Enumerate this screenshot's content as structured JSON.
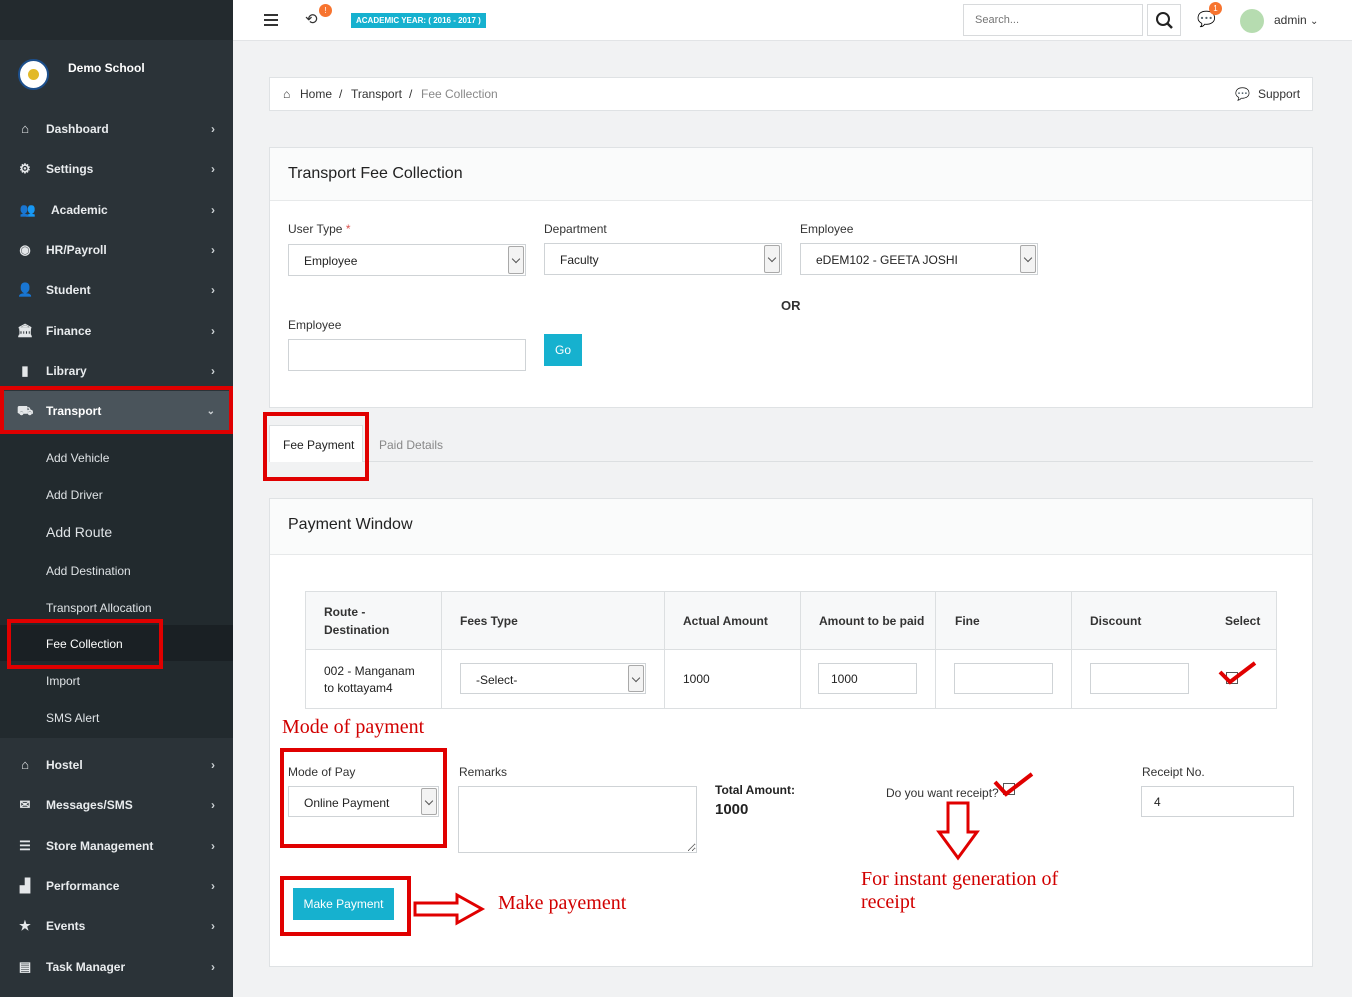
{
  "app": {
    "school_name": "Demo School",
    "academic_year": "ACADEMIC YEAR: ( 2016 - 2017 )",
    "sync_badge": "!",
    "chat_badge": "1",
    "search_placeholder": "Search...",
    "user": "admin"
  },
  "sidebar": {
    "items": [
      {
        "label": "Dashboard",
        "icon": "dashboard-icon"
      },
      {
        "label": "Settings",
        "icon": "gear-icon"
      },
      {
        "label": "Academic",
        "icon": "users-icon"
      },
      {
        "label": "HR/Payroll",
        "icon": "eye-icon"
      },
      {
        "label": "Student",
        "icon": "user-icon"
      },
      {
        "label": "Finance",
        "icon": "bank-icon"
      },
      {
        "label": "Library",
        "icon": "book-icon"
      },
      {
        "label": "Transport",
        "icon": "truck-icon"
      },
      {
        "label": "Hostel",
        "icon": "home-icon"
      },
      {
        "label": "Messages/SMS",
        "icon": "envelope-icon"
      },
      {
        "label": "Store Management",
        "icon": "list-icon"
      },
      {
        "label": "Performance",
        "icon": "chart-icon"
      },
      {
        "label": "Events",
        "icon": "star-icon"
      },
      {
        "label": "Task Manager",
        "icon": "tasks-icon"
      }
    ],
    "transport_sub": [
      "Add Vehicle",
      "Add Driver",
      "Add Route",
      "Add Destination",
      "Transport Allocation",
      "Fee Collection",
      "Import",
      "SMS Alert"
    ]
  },
  "breadcrumb": {
    "home": "Home",
    "transport": "Transport",
    "current": "Fee Collection",
    "support": "Support"
  },
  "form": {
    "title": "Transport Fee Collection",
    "user_type_label": "User Type",
    "required_mark": "*",
    "user_type_value": "Employee",
    "department_label": "Department",
    "department_value": "Faculty",
    "employee_label": "Employee",
    "employee_value": "eDEM102 - GEETA JOSHI",
    "or_text": "OR",
    "employee2_label": "Employee",
    "go_label": "Go"
  },
  "tabs": {
    "fee_payment": "Fee Payment",
    "paid_details": "Paid Details"
  },
  "payment": {
    "title": "Payment Window",
    "columns": {
      "route": "Route -",
      "route2": "Destination",
      "fees_type": "Fees Type",
      "actual": "Actual Amount",
      "to_pay": "Amount to be paid",
      "fine": "Fine",
      "discount": "Discount",
      "select": "Select"
    },
    "row": {
      "route_line1": "002 - Manganam",
      "route_line2": "to kottayam4",
      "fees_type": "-Select-",
      "actual": "1000",
      "to_pay": "1000"
    },
    "mode_label": "Mode of Pay",
    "mode_value": "Online Payment",
    "remarks_label": "Remarks",
    "total_label": "Total Amount:",
    "total_value": "1000",
    "receipt_question": "Do you want receipt?",
    "receipt_no_label": "Receipt No.",
    "receipt_no_value": "4",
    "make_payment": "Make Payment"
  },
  "annotations": {
    "mode_of_payment": "Mode of payment",
    "make_payment": "Make payement",
    "instant_line1": "For instant generation of",
    "instant_line2": "receipt"
  }
}
